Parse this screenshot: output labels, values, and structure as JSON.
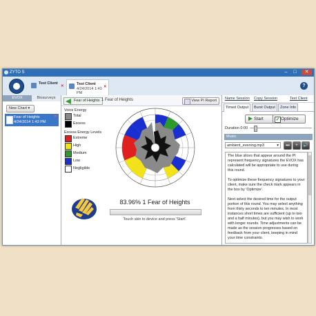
{
  "window": {
    "title": "ZYTO S"
  },
  "client_tabs": [
    {
      "name": "Test Client",
      "date": ""
    },
    {
      "name": "Test Client",
      "date": "4/24/2014 1:43 PM"
    }
  ],
  "left": {
    "tabs": [
      "EVOX",
      "Biosurveys"
    ],
    "new_chart_label": "New Chart ▾",
    "sessions": [
      {
        "name": "Fear of Heights",
        "date": "4/24/2014 1:43 PM"
      }
    ]
  },
  "center": {
    "back_label": "Fear of Heights",
    "breadcrumb": "1 Fear of Heights",
    "view_report_label": "View PI Report",
    "legend": {
      "voice_energy_title": "Voice Energy",
      "voice_items": [
        {
          "label": "Total",
          "color": "#888888"
        },
        {
          "label": "Excess",
          "color": "#000000"
        }
      ],
      "levels_title": "Excess Energy Levels",
      "level_items": [
        {
          "label": "Extreme",
          "color": "#e02020"
        },
        {
          "label": "High",
          "color": "#f2e21a"
        },
        {
          "label": "Medium",
          "color": "#2e9a2e"
        },
        {
          "label": "Low",
          "color": "#1a2fd0"
        },
        {
          "label": "Negligible",
          "color": "#ffffff"
        }
      ]
    },
    "result_text": "83.96% 1 Fear of Heights",
    "instruction": "Touch skin to device and press 'Start'."
  },
  "right": {
    "links": [
      "Name Session",
      "Copy Session",
      "Text Client"
    ],
    "tabs": [
      "Timed Output",
      "Burst Output",
      "Zone Info"
    ],
    "start_label": "Start",
    "optimize_label": "Optimize",
    "duration_label": "Duration 0:00",
    "music_header": "Music",
    "music_track": "ambient_evening.mp3",
    "music_buttons": [
      "⏭",
      "+",
      "🔊"
    ],
    "description": [
      "The blue slices that appear around the PI represent frequency signatures the EVOX has calculated will be appropriate to use during this round.",
      "To optimize these frequency signatures to your client, make sure the check mark appears in the box by 'Optimize'.",
      "Next select the desired time for the output portion of this round. You may select anything from thirty seconds to ten minutes. In most instances short times are sufficient (up to two and a half minutes), but you may wish to work with longer rounds. Time adjustments can be made as the session progresses based on feedback from your client, keeping in mind your time constraints."
    ]
  }
}
